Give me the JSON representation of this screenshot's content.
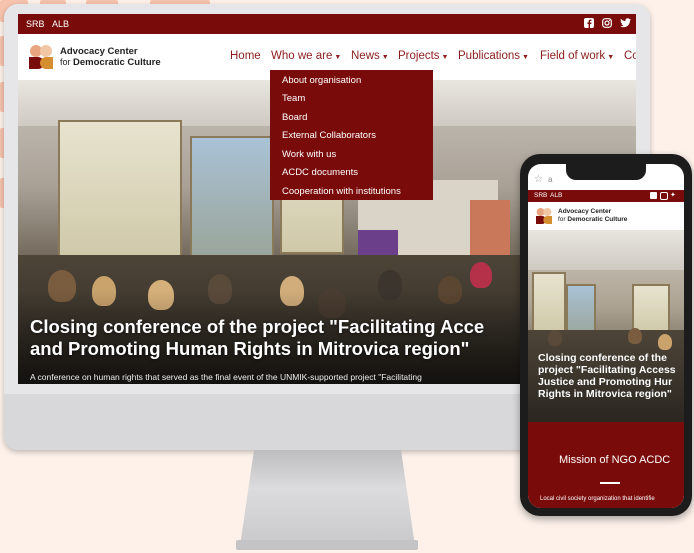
{
  "desktop": {
    "topbar": {
      "lang_srb": "SRB",
      "lang_alb": "ALB",
      "social_icons": [
        "facebook-icon",
        "instagram-icon",
        "twitter-icon"
      ]
    },
    "logo": {
      "line1": "Advocacy Center",
      "line2_prefix": "for",
      "line2": "Democratic Culture"
    },
    "nav": [
      "Home",
      "Who we are",
      "News",
      "Projects",
      "Publications",
      "Field of work",
      "Co"
    ],
    "dropdown": [
      "About organisation",
      "Team",
      "Board",
      "External Collaborators",
      "Work with us",
      "ACDC documents",
      "Cooperation with institutions"
    ],
    "hero": {
      "title_line1": "Closing conference of the project \"Facilitating Acce",
      "title_line2": "and Promoting Human Rights in Mitrovica region\"",
      "subtitle": "A conference on human rights that served as the final event of the UNMIK-supported project \"Facilitating"
    }
  },
  "mobile": {
    "address": "a",
    "topbar": {
      "lang_srb": "SRB",
      "lang_alb": "ALB"
    },
    "logo": {
      "line1": "Advocacy Center",
      "line2_prefix": "for",
      "line2": "Democratic Culture"
    },
    "hero_title": [
      "Closing conference of the",
      "project \"Facilitating Access",
      "Justice and Promoting Hur",
      "Rights in Mitrovica region\""
    ],
    "mission_title": "Mission of NGO ACDC",
    "mission_sub": "Local civil society organization that identifie"
  },
  "colors": {
    "brand": "#7a0b0b",
    "background": "#fdf1ea",
    "accent_tile": "#f6c4ad"
  }
}
